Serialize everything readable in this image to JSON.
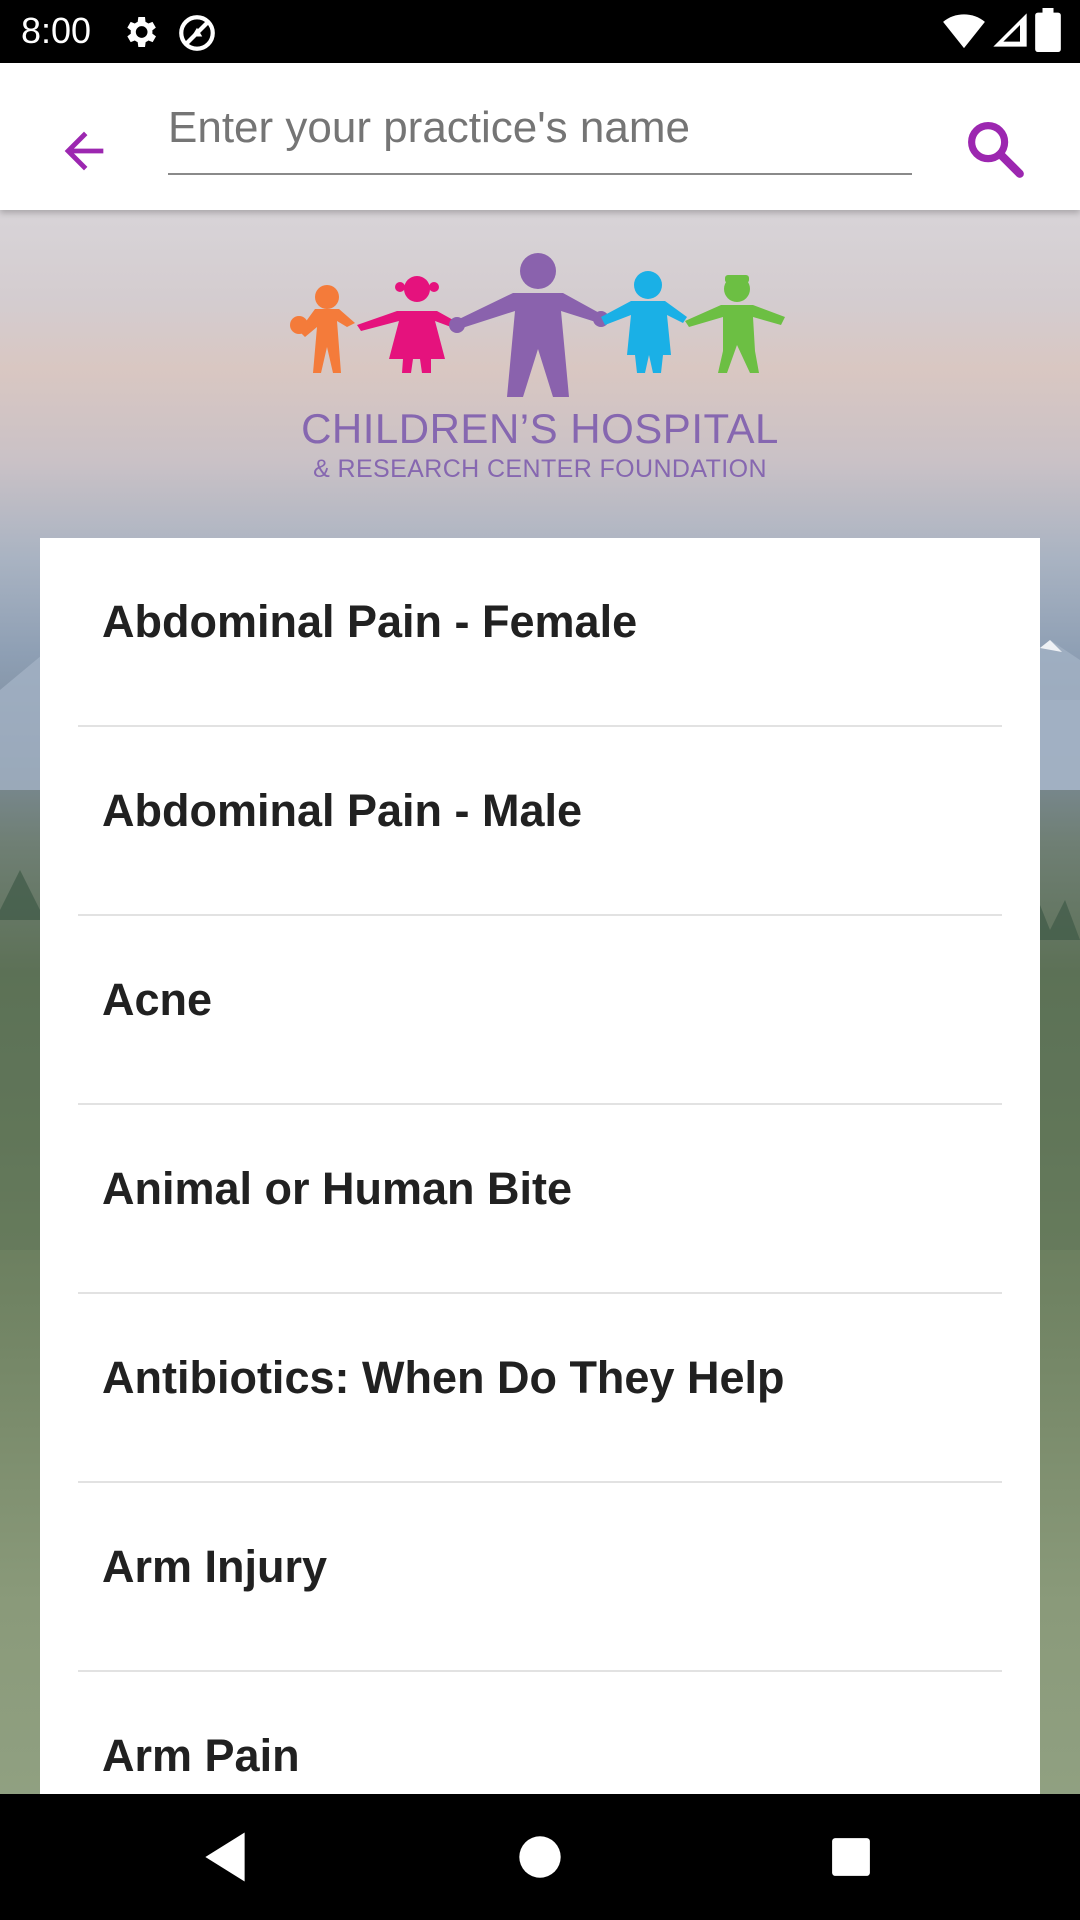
{
  "status_bar": {
    "time": "8:00",
    "icons": [
      "settings-icon",
      "data-saver-icon",
      "wifi-icon",
      "signal-icon",
      "battery-icon"
    ]
  },
  "app_bar": {
    "back_icon": "arrow-back-icon",
    "search_placeholder": "Enter your practice's name",
    "search_value": "",
    "search_icon": "search-icon",
    "accent_color": "#9c27b0"
  },
  "logo": {
    "title": "CHILDREN’S HOSPITAL",
    "subtitle": "& RESEARCH CENTER FOUNDATION",
    "figure_colors": [
      "#f47b3a",
      "#e5127d",
      "#8a62ad",
      "#1ab0e6",
      "#6cbf43"
    ],
    "text_color": "#8667b0"
  },
  "topics": [
    {
      "label": "Abdominal Pain - Female"
    },
    {
      "label": "Abdominal Pain - Male"
    },
    {
      "label": "Acne"
    },
    {
      "label": "Animal or Human Bite"
    },
    {
      "label": "Antibiotics: When Do They Help"
    },
    {
      "label": "Arm Injury"
    },
    {
      "label": "Arm Pain"
    }
  ],
  "nav_bar": {
    "buttons": [
      "back-nav-icon",
      "home-nav-icon",
      "recents-nav-icon"
    ]
  }
}
